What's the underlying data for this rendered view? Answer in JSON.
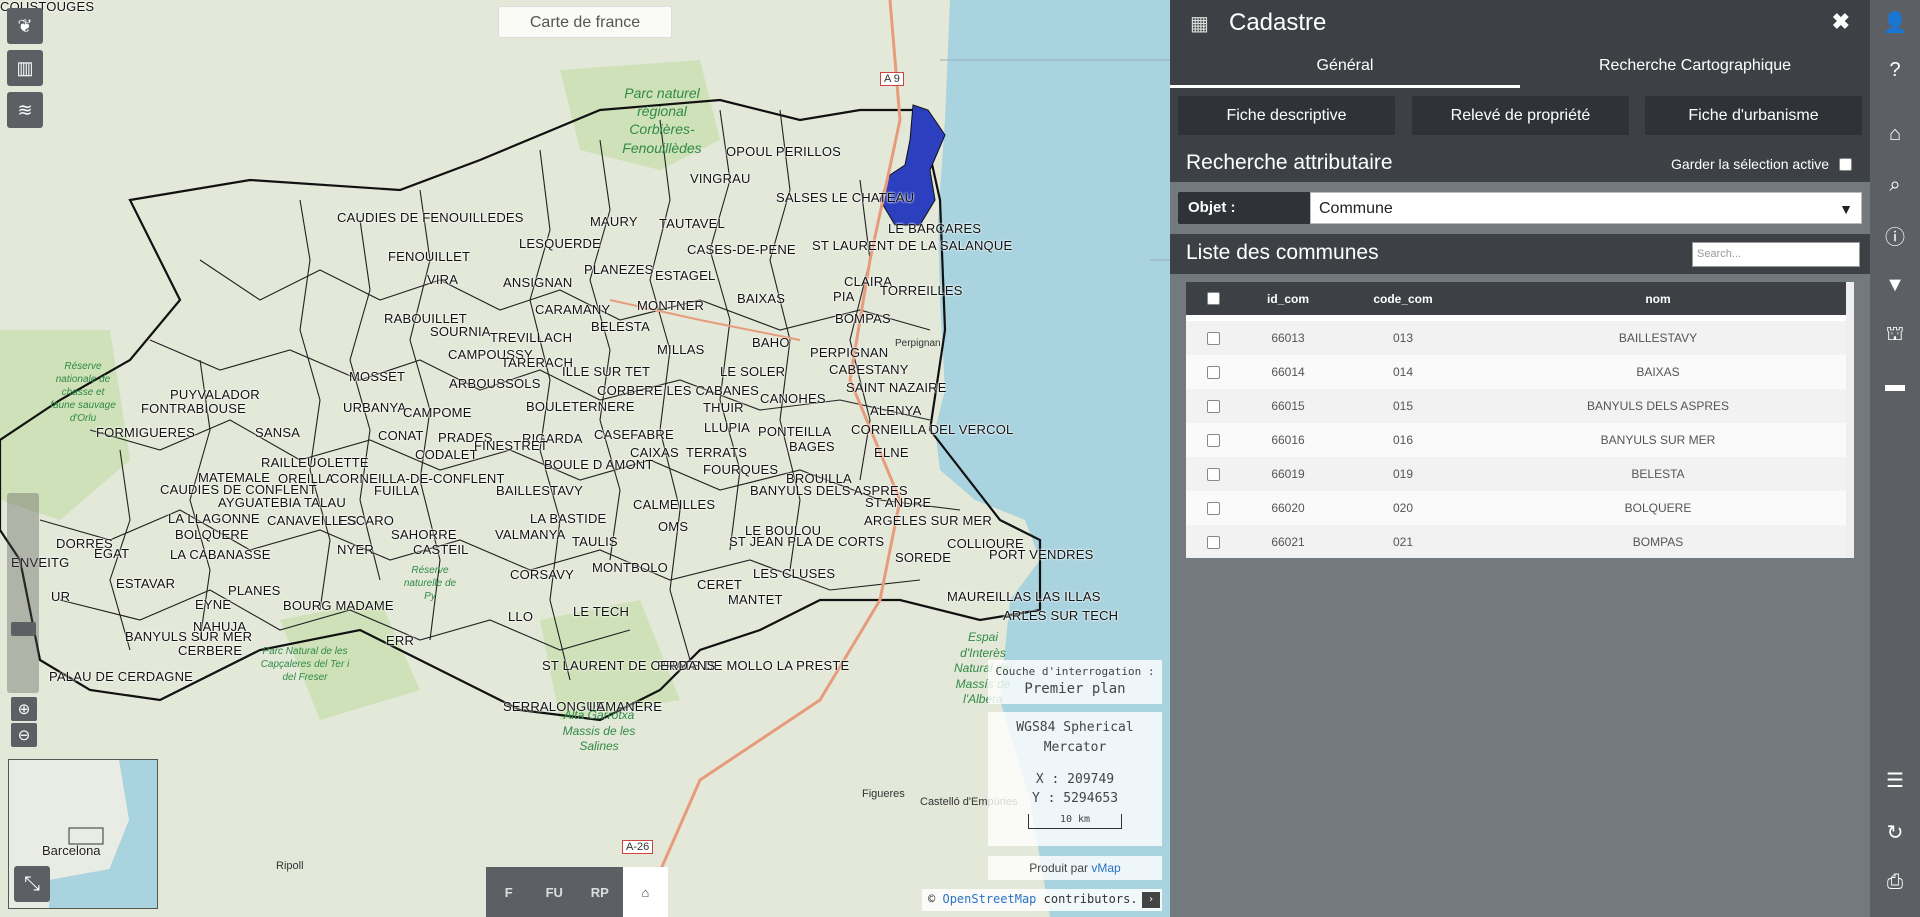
{
  "map": {
    "title": "Carte de france",
    "communes": [
      "OPOUL PERILLOS",
      "VINGRAU",
      "SALSES LE CHATEAU",
      "LE BARCARES",
      "CAUDIES DE FENOUILLEDES",
      "MAURY",
      "TAUTAVEL",
      "ST LAURENT DE LA SALANQUE",
      "LESQUERDE",
      "CASES-DE-PENE",
      "FENOUILLET",
      "PLANEZES",
      "ESTAGEL",
      "CLAIRA",
      "TORREILLES",
      "VIRA",
      "ANSIGNAN",
      "CARAMANY",
      "MONTNER",
      "BAIXAS",
      "PIA",
      "BOMPAS",
      "RABOUILLET",
      "SOURNIA",
      "TREVILLACH",
      "BELESTA",
      "BAHO",
      "CAMPOUSSY",
      "MILLAS",
      "PERPIGNAN",
      "MOSSET",
      "TARERACH",
      "ILLE SUR TET",
      "LE SOLER",
      "CABESTANY",
      "PUYVALADOR",
      "ARBOUSSOLS",
      "CORBERE LES CABANES",
      "SAINT NAZAIRE",
      "FONTRABIOUSE",
      "URBANYA",
      "CAMPOME",
      "BOULETERNERE",
      "THUIR",
      "CANOHES",
      "ALENYA",
      "FORMIGUERES",
      "SANSA",
      "CONAT",
      "PRADES",
      "RIGARDA",
      "CASEFABRE",
      "LLUPIA",
      "PONTEILLA",
      "CORNEILLA DEL VERCOL",
      "RAILLEU",
      "OLETTE",
      "CODALET",
      "FINESTRET",
      "TERRATS",
      "BAGES",
      "ELNE",
      "MATEMALE",
      "OREILLA",
      "CORNEILLA-DE-CONFLENT",
      "BOULE D AMONT",
      "CAIXAS",
      "FOURQUES",
      "BROUILLA",
      "CAUDIES DE CONFLENT",
      "FUILLA",
      "BAILLESTAVY",
      "BANYULS DELS ASPRES",
      "LA LLAGONNE",
      "AYGUATEBIA TALAU",
      "LA BASTIDE",
      "CALMEILLES",
      "ST ANDRE",
      "BOLQUERE",
      "CANAVEILLES",
      "ESCARO",
      "OMS",
      "ARGELES SUR MER",
      "DORRES",
      "EGAT",
      "LA CABANASSE",
      "SAHORRE",
      "LE BOULOU",
      "ENVEITG",
      "NYER",
      "CASTEIL",
      "VALMANYA",
      "TAULIS",
      "ST JEAN PLA DE CORTS",
      "COLLIOURE",
      "ESTAVAR",
      "PORT VENDRES",
      "SOREDE",
      "MONTBOLO",
      "LES CLUSES",
      "UR",
      "EYNE",
      "PLANES",
      "CORSAVY",
      "CERET",
      "BOURG MADAME",
      "MANTET",
      "MAUREILLAS LAS ILLAS",
      "BANYULS SUR MER",
      "NAHUJA",
      "LLO",
      "LE TECH",
      "ARLES SUR TECH",
      "CERBERE",
      "ERR",
      "PRATS DE MOLLO LA PRESTE",
      "PALAU DE CERDAGNE",
      "ST LAURENT DE CERDANS",
      "SERRALONGUE",
      "LAMANERE",
      "COUSTOUGES"
    ],
    "park_corbieres": "Parc naturel régional Corbières-Fenouillèdes",
    "reserve_mantet": "Réserve nationale de chasse et faune sauvage d'Orlu",
    "reserve_py": "Réserve naturelle de Py",
    "park_pyrenees": "Parc Natural de les Capçaleres del Ter i del Freser",
    "alta_garrotxa": "Alta Garrotxa Massis de les Salines",
    "espai": "Espai d'Interès Natural del Massís de l'Albera",
    "road_a9": "A 9",
    "road_a26": "A-26",
    "figueres": "Figueres",
    "castello": "Castelló d'Empúries",
    "ripoll": "Ripoll",
    "perpignan_small": "Perpignan",
    "overview_label": "Barcelona",
    "bottom_tools": [
      "F",
      "FU",
      "RP",
      "⌂"
    ],
    "layer_box": {
      "label": "Couche d'interrogation :",
      "value": "Premier plan"
    },
    "proj_box": {
      "name": "WGS84 Spherical Mercator",
      "x": "X : 209749",
      "y": "Y : 5294653",
      "scale": "10 km"
    },
    "vmap": {
      "prefix": "Produit par",
      "name": "vMap"
    },
    "attribution": {
      "prefix": "©",
      "link": "OpenStreetMap",
      "suffix": "contributors."
    }
  },
  "panel": {
    "title": "Cadastre",
    "tabs": [
      "Général",
      "Recherche Cartographique"
    ],
    "actions": [
      "Fiche descriptive",
      "Relevé de propriété",
      "Fiche d'urbanisme"
    ],
    "search_section": {
      "title": "Recherche attributaire",
      "keep_label": "Garder la sélection active"
    },
    "objet": {
      "label": "Objet :",
      "value": "Commune"
    },
    "list_section": {
      "title": "Liste des communes",
      "search_placeholder": "Search..."
    },
    "table": {
      "headers": [
        "id_com",
        "code_com",
        "nom"
      ],
      "rows": [
        [
          "66013",
          "013",
          "BAILLESTAVY"
        ],
        [
          "66014",
          "014",
          "BAIXAS"
        ],
        [
          "66015",
          "015",
          "BANYULS DELS ASPRES"
        ],
        [
          "66016",
          "016",
          "BANYULS SUR MER"
        ],
        [
          "66019",
          "019",
          "BELESTA"
        ],
        [
          "66020",
          "020",
          "BOLQUERE"
        ],
        [
          "66021",
          "021",
          "BOMPAS"
        ]
      ]
    }
  }
}
